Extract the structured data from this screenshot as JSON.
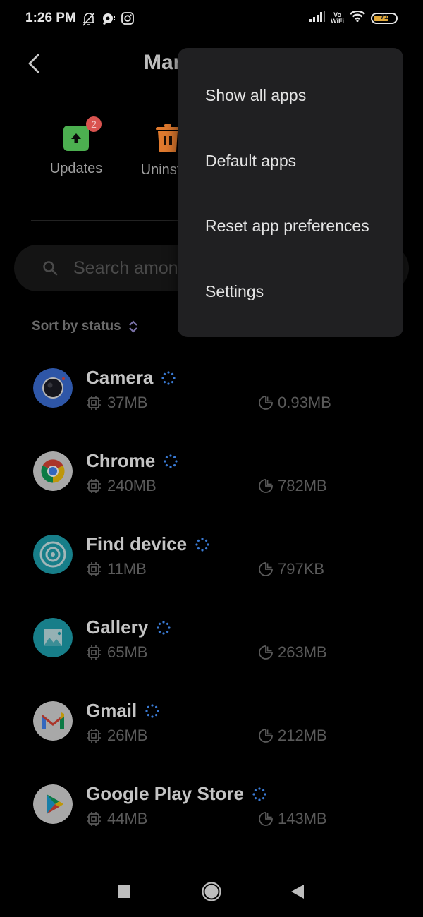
{
  "status_bar": {
    "time": "1:26 PM",
    "left_icons": [
      "bell-off-icon",
      "chat-bubble-icon",
      "instagram-icon"
    ],
    "right_icons": [
      "cellular-signal-icon",
      "vowifi-icon",
      "wifi-icon",
      "battery-icon"
    ],
    "vowifi_top": "Vo",
    "vowifi_bottom": "WiFi",
    "battery_level": "71",
    "battery_percent": 71,
    "battery_color": "#e0a83a"
  },
  "header": {
    "back_icon": "chevron-left-icon",
    "title": "Manage apps"
  },
  "quick_actions": [
    {
      "label": "Updates",
      "icon": "upload-arrow-icon",
      "badge": "2",
      "color": "#4caf50"
    },
    {
      "label": "Uninstall",
      "icon": "trash-icon",
      "color": "#e07a2e"
    }
  ],
  "search": {
    "placeholder": "Search among installed apps",
    "value": ""
  },
  "sort": {
    "label": "Sort by status",
    "icon": "sort-updown-icon"
  },
  "apps": [
    {
      "name": "Camera",
      "ram": "37MB",
      "storage": "0.93MB",
      "icon": "camera-icon"
    },
    {
      "name": "Chrome",
      "ram": "240MB",
      "storage": "782MB",
      "icon": "chrome-icon"
    },
    {
      "name": "Find device",
      "ram": "11MB",
      "storage": "797KB",
      "icon": "find-device-icon"
    },
    {
      "name": "Gallery",
      "ram": "65MB",
      "storage": "263MB",
      "icon": "gallery-icon"
    },
    {
      "name": "Gmail",
      "ram": "26MB",
      "storage": "212MB",
      "icon": "gmail-icon"
    },
    {
      "name": "Google Play Store",
      "ram": "44MB",
      "storage": "143MB",
      "icon": "play-store-icon"
    }
  ],
  "menu": {
    "items": [
      {
        "label": "Show all apps"
      },
      {
        "label": "Default apps"
      },
      {
        "label": "Reset app preferences"
      },
      {
        "label": "Settings"
      }
    ]
  },
  "nav_bar": {
    "buttons": [
      "recents-button",
      "home-button",
      "back-button"
    ]
  }
}
